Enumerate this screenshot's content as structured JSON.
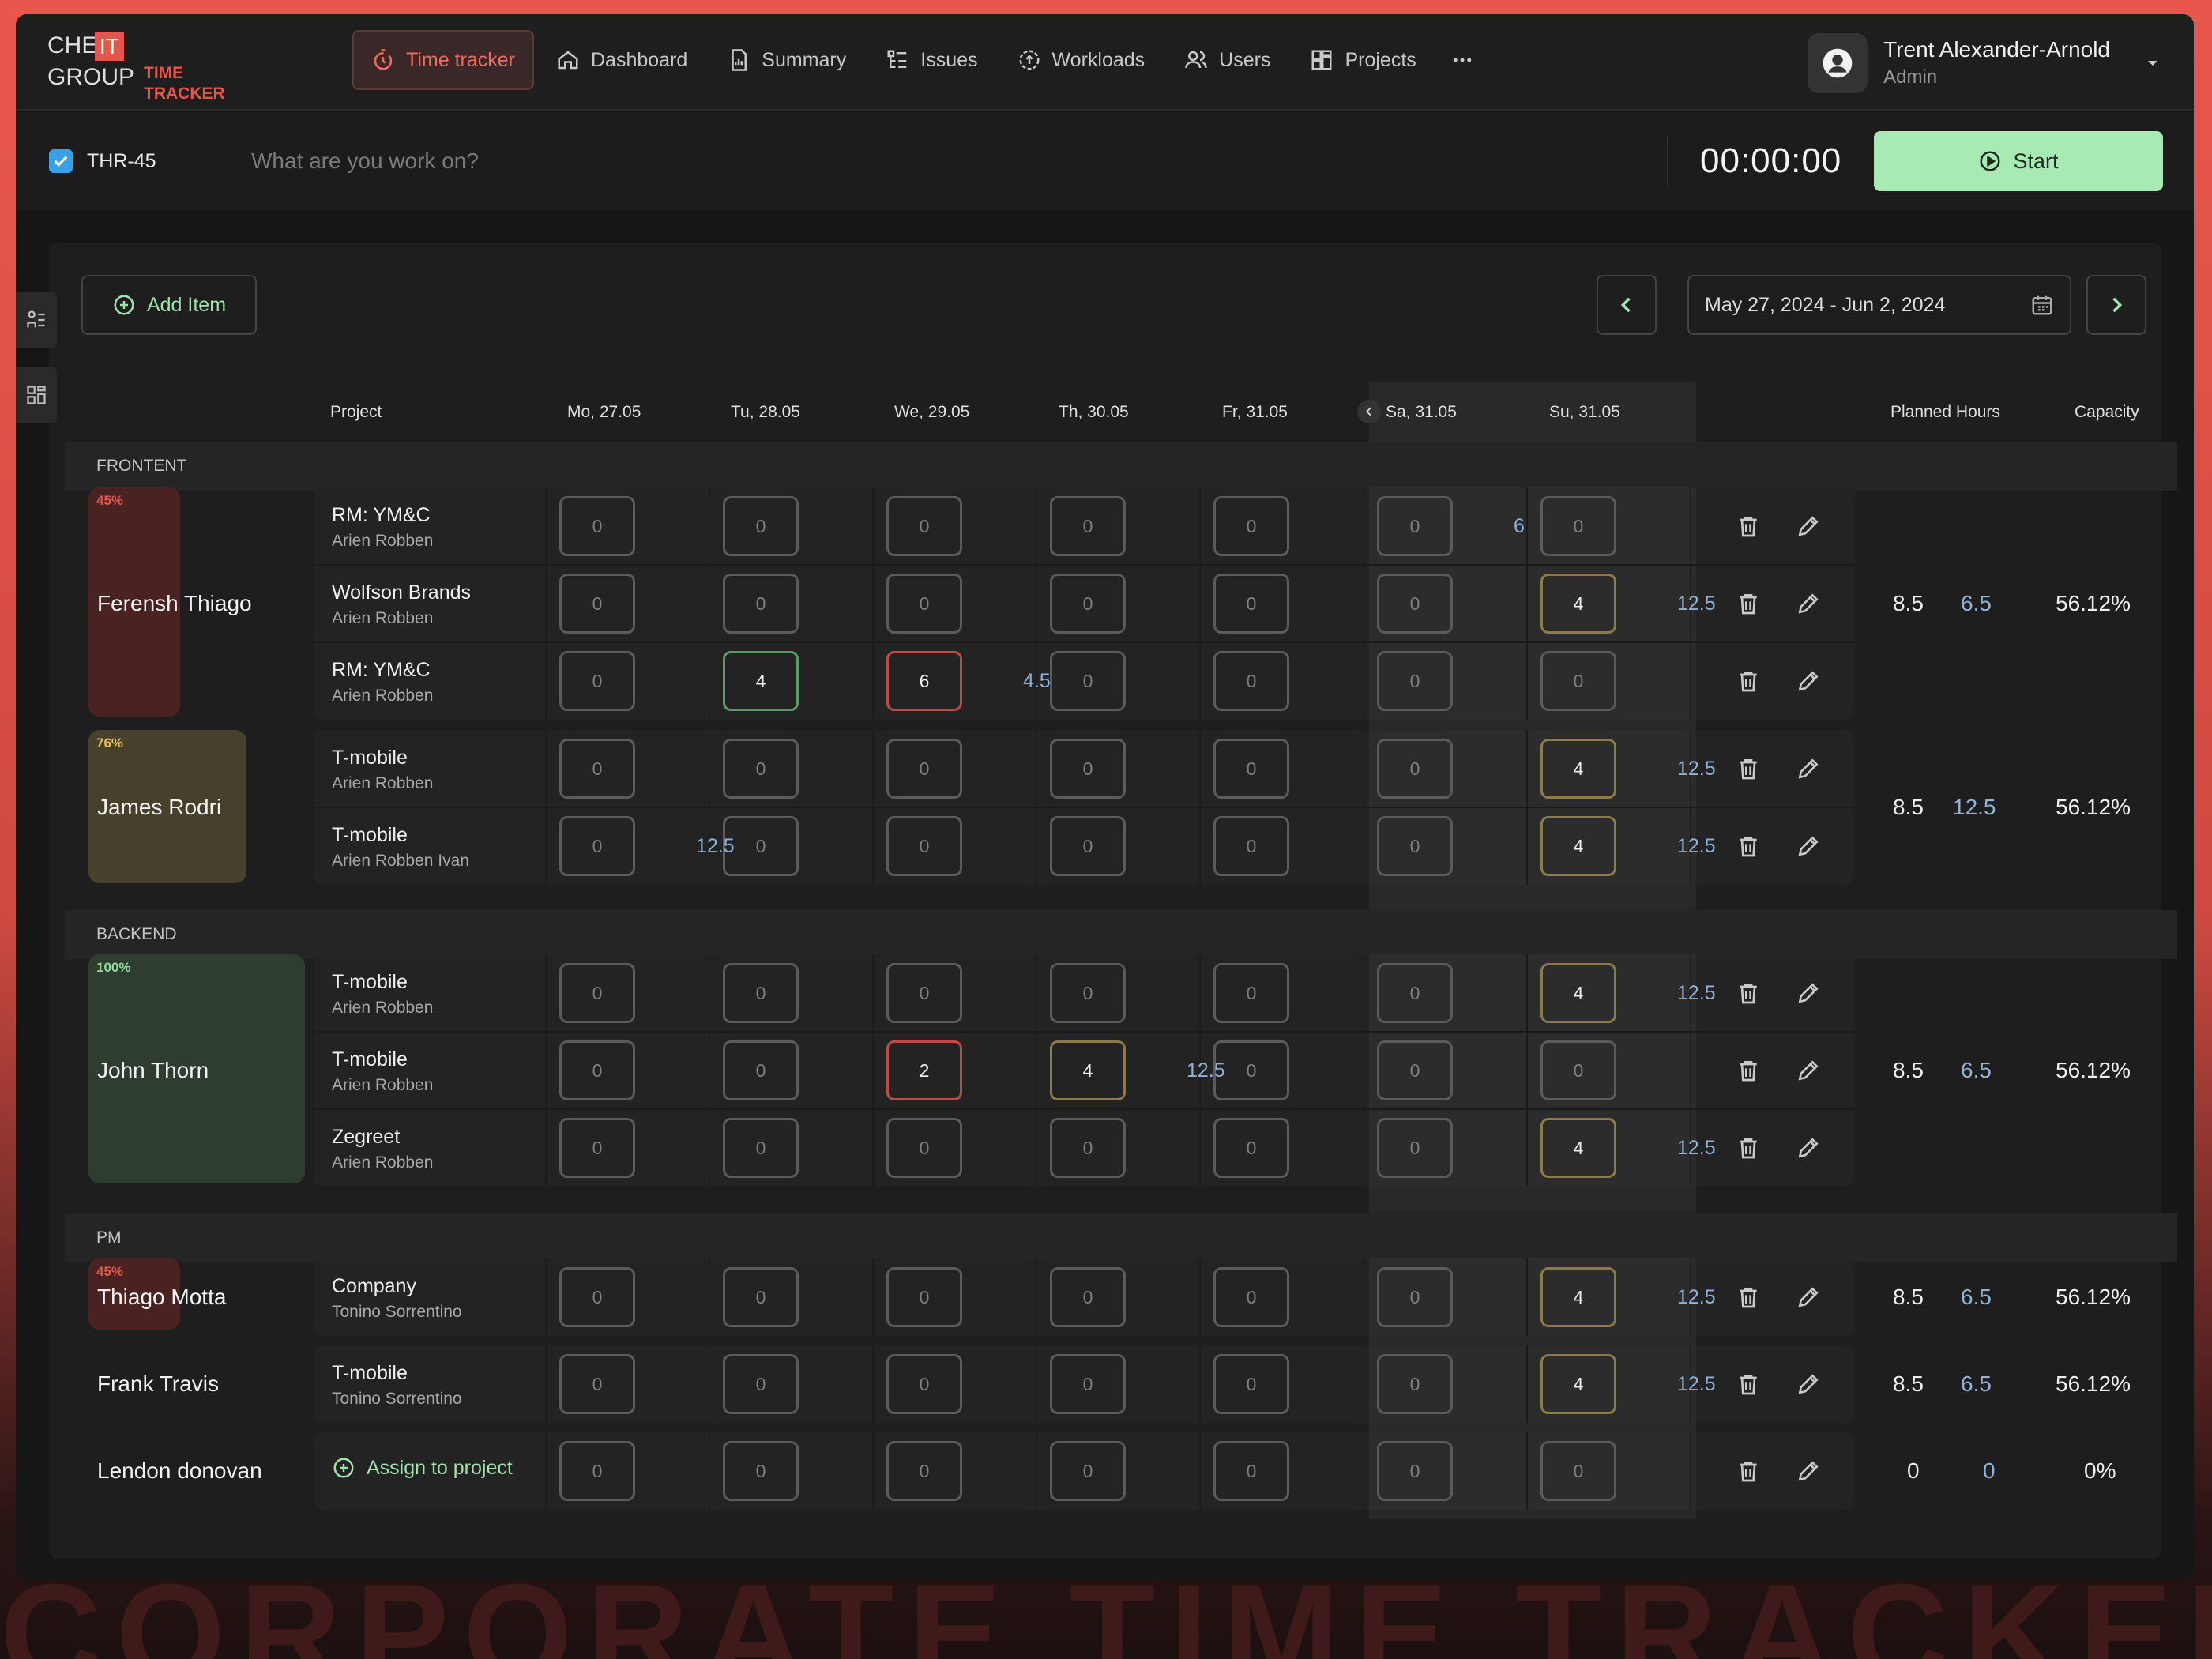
{
  "background_text": "CORPORATE TIME TRACKER",
  "logo": {
    "che": "CHE",
    "it": "IT",
    "group": "GROUP",
    "sub_line1": "TIME",
    "sub_line2": "TRACKER"
  },
  "nav": [
    {
      "label": "Time tracker",
      "icon": "stopwatch-icon",
      "active": true
    },
    {
      "label": "Dashboard",
      "icon": "home-icon"
    },
    {
      "label": "Summary",
      "icon": "report-icon"
    },
    {
      "label": "Issues",
      "icon": "issues-icon"
    },
    {
      "label": "Workloads",
      "icon": "workload-icon"
    },
    {
      "label": "Users",
      "icon": "users-icon"
    },
    {
      "label": "Projects",
      "icon": "projects-icon"
    }
  ],
  "user": {
    "name": "Trent Alexander-Arnold",
    "role": "Admin"
  },
  "timer": {
    "task_id": "THR-45",
    "placeholder": "What are you work on?",
    "time": "00:00:00",
    "start_label": "Start"
  },
  "toolbar": {
    "add_item_label": "Add Item",
    "date_range": "May 27, 2024 - Jun 2, 2024"
  },
  "headers": {
    "project": "Project",
    "days": [
      "Mo, 27.05",
      "Tu, 28.05",
      "We, 29.05",
      "Th, 30.05",
      "Fr, 31.05",
      "Sa, 31.05",
      "Su, 31.05"
    ],
    "planned": "Planned Hours",
    "capacity": "Capacity"
  },
  "groups": [
    {
      "name": "FRONTENT"
    },
    {
      "name": "BACKEND"
    },
    {
      "name": "PM"
    }
  ],
  "people": [
    {
      "name": "Ferensh Thiago",
      "load_pct": "45%",
      "load_color": "#e2574b",
      "planned": "8.5",
      "secondary": "6.5",
      "capacity": "56.12%",
      "rows": [
        {
          "project": "RM: YM&C",
          "members": "Arien Robben",
          "hours": [
            "0",
            "0",
            "0",
            "0",
            "0",
            "0",
            "0"
          ],
          "extra": {
            "day": 5,
            "value": "6"
          }
        },
        {
          "project": "Wolfson Brands",
          "members": "Arien Robben",
          "hours": [
            "0",
            "0",
            "0",
            "0",
            "0",
            "0",
            "4"
          ],
          "extra": {
            "day": 6,
            "value": "12.5"
          }
        },
        {
          "project": "RM: YM&C",
          "members": "Arien Robben",
          "hours": [
            "0",
            "4",
            "6",
            "0",
            "0",
            "0",
            "0"
          ],
          "extra": {
            "day": 2,
            "value": "4.5"
          }
        }
      ]
    },
    {
      "name": "James Rodri",
      "load_pct": "76%",
      "load_color": "#e8c25a",
      "planned": "8.5",
      "secondary": "12.5",
      "capacity": "56.12%",
      "rows": [
        {
          "project": "T-mobile",
          "members": "Arien Robben",
          "hours": [
            "0",
            "0",
            "0",
            "0",
            "0",
            "0",
            "4"
          ],
          "extra": {
            "day": 6,
            "value": "12.5"
          }
        },
        {
          "project": "T-mobile",
          "members": "Arien Robben Ivan",
          "hours": [
            "0",
            "0",
            "0",
            "0",
            "0",
            "0",
            "4"
          ],
          "extra": {
            "day": 0,
            "value": "12.5"
          },
          "extra2": {
            "day": 6,
            "value": "12.5"
          }
        }
      ]
    },
    {
      "name": "John Thorn",
      "load_pct": "100%",
      "load_color": "#8fdc9a",
      "planned": "8.5",
      "secondary": "6.5",
      "capacity": "56.12%",
      "rows": [
        {
          "project": "T-mobile",
          "members": "Arien Robben",
          "hours": [
            "0",
            "0",
            "0",
            "0",
            "0",
            "0",
            "4"
          ],
          "extra": {
            "day": 6,
            "value": "12.5"
          }
        },
        {
          "project": "T-mobile",
          "members": "Arien Robben",
          "hours": [
            "0",
            "0",
            "2",
            "4",
            "0",
            "0",
            "0"
          ],
          "extra": {
            "day": 3,
            "value": "12.5"
          }
        },
        {
          "project": "Zegreet",
          "members": "Arien Robben",
          "hours": [
            "0",
            "0",
            "0",
            "0",
            "0",
            "0",
            "4"
          ],
          "extra": {
            "day": 6,
            "value": "12.5"
          }
        }
      ]
    },
    {
      "name": "Thiago Motta",
      "load_pct": "45%",
      "load_color": "#e2574b",
      "planned": "8.5",
      "secondary": "6.5",
      "capacity": "56.12%",
      "rows": [
        {
          "project": "Company",
          "members": "Tonino Sorrentino",
          "hours": [
            "0",
            "0",
            "0",
            "0",
            "0",
            "0",
            "4"
          ],
          "extra": {
            "day": 6,
            "value": "12.5"
          }
        }
      ]
    },
    {
      "name": "Frank Travis",
      "planned": "8.5",
      "secondary": "6.5",
      "capacity": "56.12%",
      "rows": [
        {
          "project": "T-mobile",
          "members": "Tonino Sorrentino",
          "hours": [
            "0",
            "0",
            "0",
            "0",
            "0",
            "0",
            "4"
          ],
          "extra": {
            "day": 6,
            "value": "12.5"
          }
        }
      ]
    },
    {
      "name": "Lendon donovan",
      "planned": "0",
      "secondary": "0",
      "capacity": "0%",
      "assign_label": "Assign to project",
      "rows": [
        {
          "hours": [
            "0",
            "0",
            "0",
            "0",
            "0",
            "0",
            "0"
          ]
        }
      ]
    }
  ]
}
